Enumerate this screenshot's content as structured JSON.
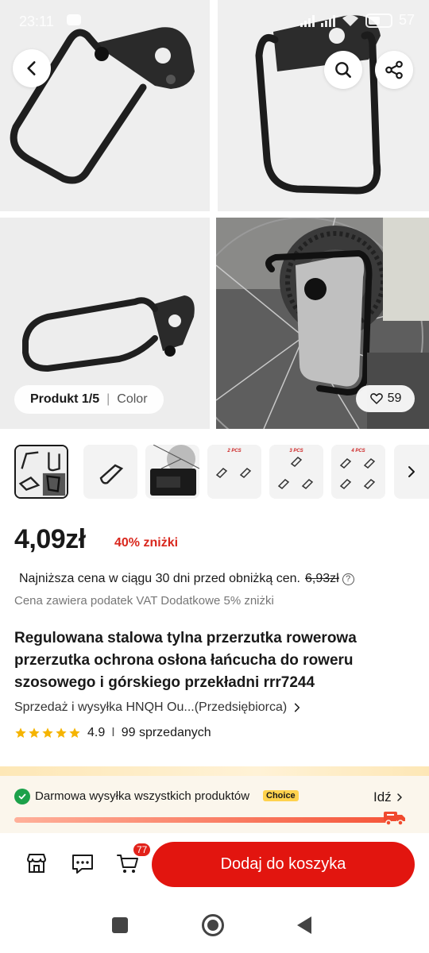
{
  "status_bar": {
    "time": "23:11",
    "battery": "57"
  },
  "gallery": {
    "position_label": "Produkt 1/5",
    "variant_label": "Color",
    "likes": "59",
    "thumb_labels": [
      "2 PCS",
      "3 PCS",
      "4 PCS"
    ]
  },
  "pricing": {
    "price": "4,09zł",
    "discount": "40% zniżki",
    "lowest_price_label": "Najniższa cena w ciągu 30 dni przed obniżką cen.",
    "lowest_price_value": "6,93zł",
    "info_glyph": "?",
    "vat_note": "Cena zawiera podatek VAT Dodatkowe 5% zniżki"
  },
  "product": {
    "title": "Regulowana stalowa tylna przerzutka rowerowa przerzutka ochrona osłona łańcucha do roweru szosowego i górskiego przekładni rrr7244",
    "seller": "Sprzedaż i wysyłka HNQH Ou...(Przedsiębiorca)",
    "rating": "4.9",
    "separator": "I",
    "sold": "99 sprzedanych",
    "stars": 5
  },
  "shipping": {
    "text": "Darmowa wysyłka wszystkich produktów",
    "badge": "Choice",
    "go_label": "Idź",
    "progress": 1.0
  },
  "action_bar": {
    "cart_count": "77",
    "add_to_cart": "Dodaj do koszyka"
  },
  "icons": {
    "back": "back-icon",
    "search": "search-icon",
    "share": "share-icon",
    "heart": "heart-icon",
    "store": "store-icon",
    "chat": "chat-icon",
    "cart": "cart-icon"
  },
  "colors": {
    "accent": "#e2150f",
    "discount": "#d9271d",
    "check": "#1ca14a",
    "choice_badge": "#ffd24d"
  }
}
